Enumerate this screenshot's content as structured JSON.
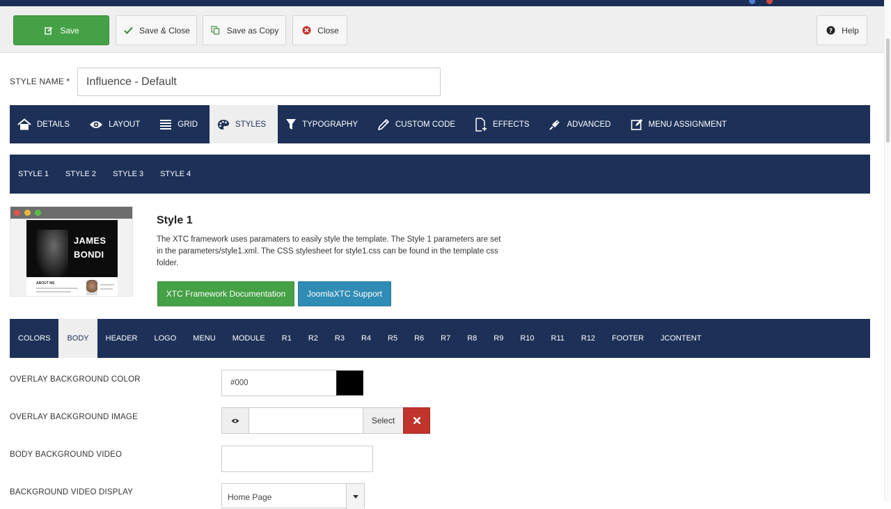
{
  "colors": {
    "primary_nav": "#1d3158",
    "success": "#45a146",
    "info": "#2f8cb5",
    "danger": "#c0342b"
  },
  "toolbar": {
    "save": {
      "label": "Save",
      "icon": "edit-icon"
    },
    "save_close": {
      "label": "Save & Close",
      "icon": "check-icon"
    },
    "save_copy": {
      "label": "Save as Copy",
      "icon": "copy-icon"
    },
    "close": {
      "label": "Close",
      "icon": "close-circle-icon"
    },
    "help": {
      "label": "Help",
      "icon": "question-circle-icon"
    }
  },
  "style_name": {
    "label": "STYLE NAME *",
    "value": "Influence - Default"
  },
  "main_tabs": [
    {
      "label": "DETAILS",
      "icon": "home-icon"
    },
    {
      "label": "LAYOUT",
      "icon": "eye-icon"
    },
    {
      "label": "GRID",
      "icon": "list-icon"
    },
    {
      "label": "STYLES",
      "icon": "palette-icon",
      "active": true
    },
    {
      "label": "TYPOGRAPHY",
      "icon": "filter-icon"
    },
    {
      "label": "CUSTOM CODE",
      "icon": "pencil-icon"
    },
    {
      "label": "EFFECTS",
      "icon": "new-file-icon"
    },
    {
      "label": "ADVANCED",
      "icon": "plug-icon"
    },
    {
      "label": "MENU ASSIGNMENT",
      "icon": "edit-square-icon"
    }
  ],
  "style_tabs": [
    "STYLE 1",
    "STYLE 2",
    "STYLE 3",
    "STYLE 4"
  ],
  "style_panel": {
    "title": "Style 1",
    "description": "The XTC framework uses paramaters to easily style the template. The Style 1 parameters are set in the parameters/style1.xml. The CSS stylesheet for style1.css can be found in the template css folder.",
    "preview_name_line1": "JAMES",
    "preview_name_line2": "BONDI",
    "preview_about": "ABOUT ME",
    "doc_button": "XTC Framework Documentation",
    "support_button": "JoomlaXTC Support"
  },
  "section_tabs": [
    "COLORS",
    "BODY",
    "HEADER",
    "LOGO",
    "MENU",
    "MODULE",
    "R1",
    "R2",
    "R3",
    "R4",
    "R5",
    "R6",
    "R7",
    "R8",
    "R9",
    "R10",
    "R11",
    "R12",
    "FOOTER",
    "JCONTENT"
  ],
  "section_active": "BODY",
  "fields": {
    "overlay_bg_color": {
      "label": "OVERLAY BACKGROUND COLOR",
      "value": "#000",
      "swatch": "#000000"
    },
    "overlay_bg_image": {
      "label": "OVERLAY BACKGROUND IMAGE",
      "value": "",
      "select_label": "Select"
    },
    "body_bg_video": {
      "label": "BODY BACKGROUND VIDEO",
      "value": ""
    },
    "bg_video_display": {
      "label": "BACKGROUND VIDEO DISPLAY",
      "value": "Home Page"
    }
  }
}
